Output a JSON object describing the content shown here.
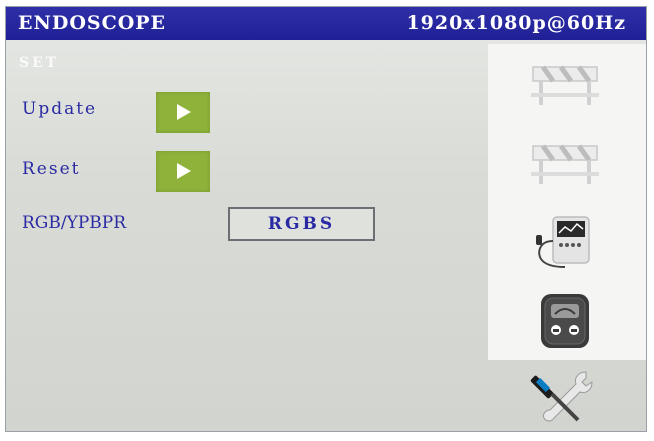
{
  "title_bar": {
    "app_title": "ENDOSCOPE",
    "resolution": "1920x1080p@60Hz"
  },
  "section": {
    "label": "SET"
  },
  "rows": [
    {
      "label": "Update",
      "control": "play-button"
    },
    {
      "label": "Reset",
      "control": "play-button"
    },
    {
      "label": "RGB/YPBPR",
      "value": "RGBS"
    }
  ],
  "side_tabs": [
    {
      "icon": "barrier-icon",
      "state": "inactive"
    },
    {
      "icon": "barrier-icon",
      "state": "inactive"
    },
    {
      "icon": "monitor-device-icon",
      "state": "inactive"
    },
    {
      "icon": "control-panel-icon",
      "state": "inactive"
    },
    {
      "icon": "tools-icon",
      "state": "active"
    }
  ],
  "colors": {
    "title_bar": "#2222a0",
    "label_text": "#2a2aa4",
    "play_button": "#8eb23a",
    "background": "#dcdedb"
  }
}
